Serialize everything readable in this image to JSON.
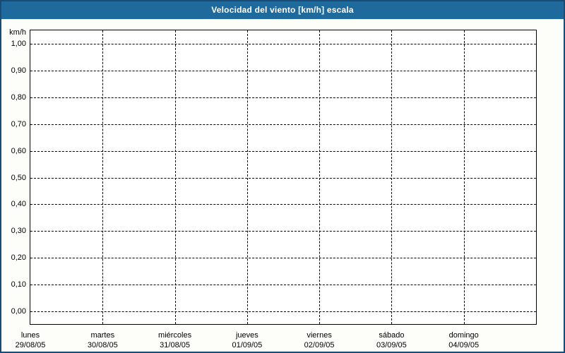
{
  "window": {
    "background": "#fdfefa",
    "border_color": "#1b4b74"
  },
  "title_bar": {
    "label": "Velocidad del viento [km/h] escala",
    "background": "#1f6a9d",
    "text_color": "#ffffff"
  },
  "chart_data": {
    "type": "line",
    "title": "Velocidad del viento [km/h] escala",
    "ylabel": "km/h",
    "xlabel": "",
    "ylim": [
      0.0,
      1.0
    ],
    "y_tick_step": 0.1,
    "y_tick_labels": [
      "1,00",
      "0,90",
      "0,80",
      "0,70",
      "0,60",
      "0,50",
      "0,40",
      "0,30",
      "0,20",
      "0,10",
      "0,00"
    ],
    "categories": [
      {
        "day": "lunes",
        "date": "29/08/05"
      },
      {
        "day": "martes",
        "date": "30/08/05"
      },
      {
        "day": "miércoles",
        "date": "31/08/05"
      },
      {
        "day": "jueves",
        "date": "01/09/05"
      },
      {
        "day": "viernes",
        "date": "02/09/05"
      },
      {
        "day": "sábado",
        "date": "03/09/05"
      },
      {
        "day": "domingo",
        "date": "04/09/05"
      }
    ],
    "series": [],
    "grid": "dashed",
    "gridline_color": "#000000",
    "plot_background": "#ffffff",
    "legend": "none"
  }
}
